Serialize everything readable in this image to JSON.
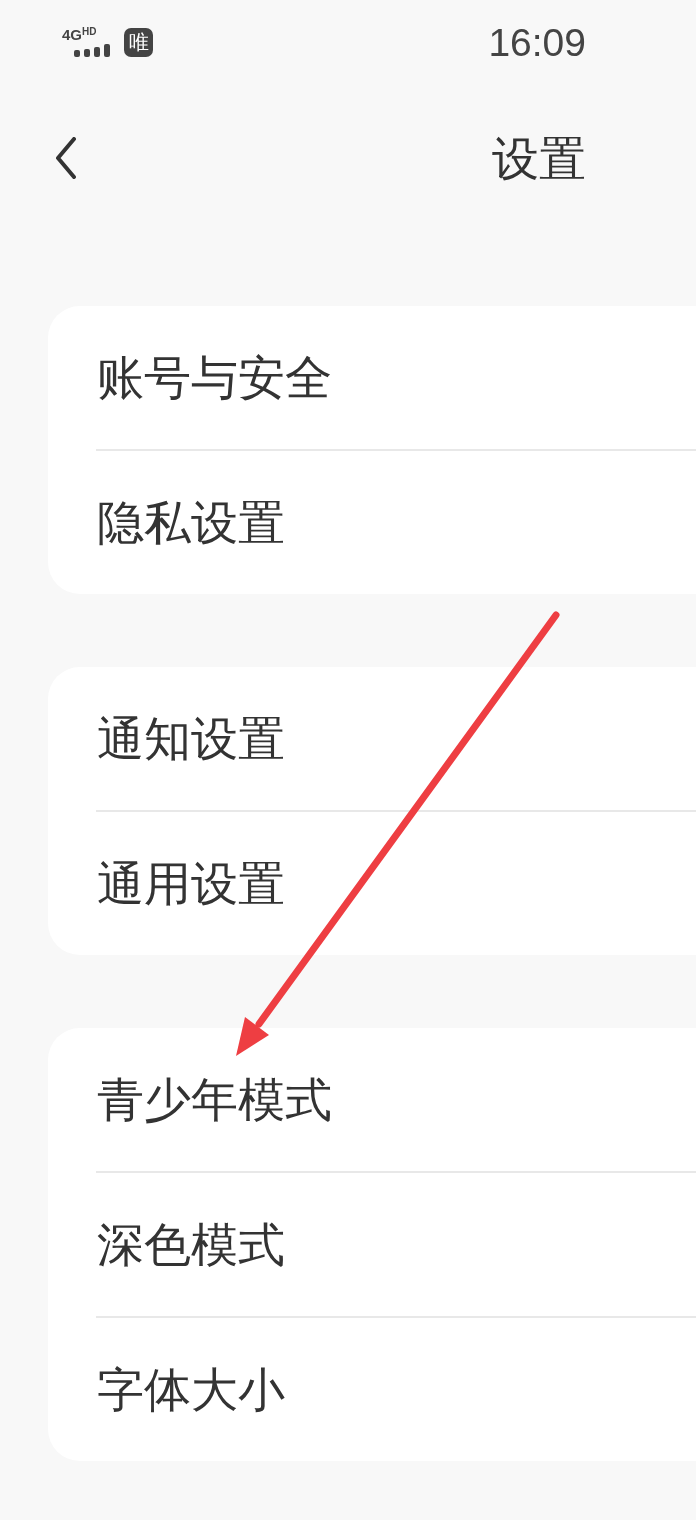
{
  "status_bar": {
    "network": "4G",
    "network_badge": "HD",
    "badge": "唯",
    "time": "16:09"
  },
  "header": {
    "title": "设置"
  },
  "groups": [
    {
      "items": [
        {
          "label": "账号与安全"
        },
        {
          "label": "隐私设置"
        }
      ]
    },
    {
      "items": [
        {
          "label": "通知设置"
        },
        {
          "label": "通用设置"
        }
      ]
    },
    {
      "items": [
        {
          "label": "青少年模式"
        },
        {
          "label": "深色模式"
        },
        {
          "label": "字体大小"
        }
      ]
    }
  ]
}
